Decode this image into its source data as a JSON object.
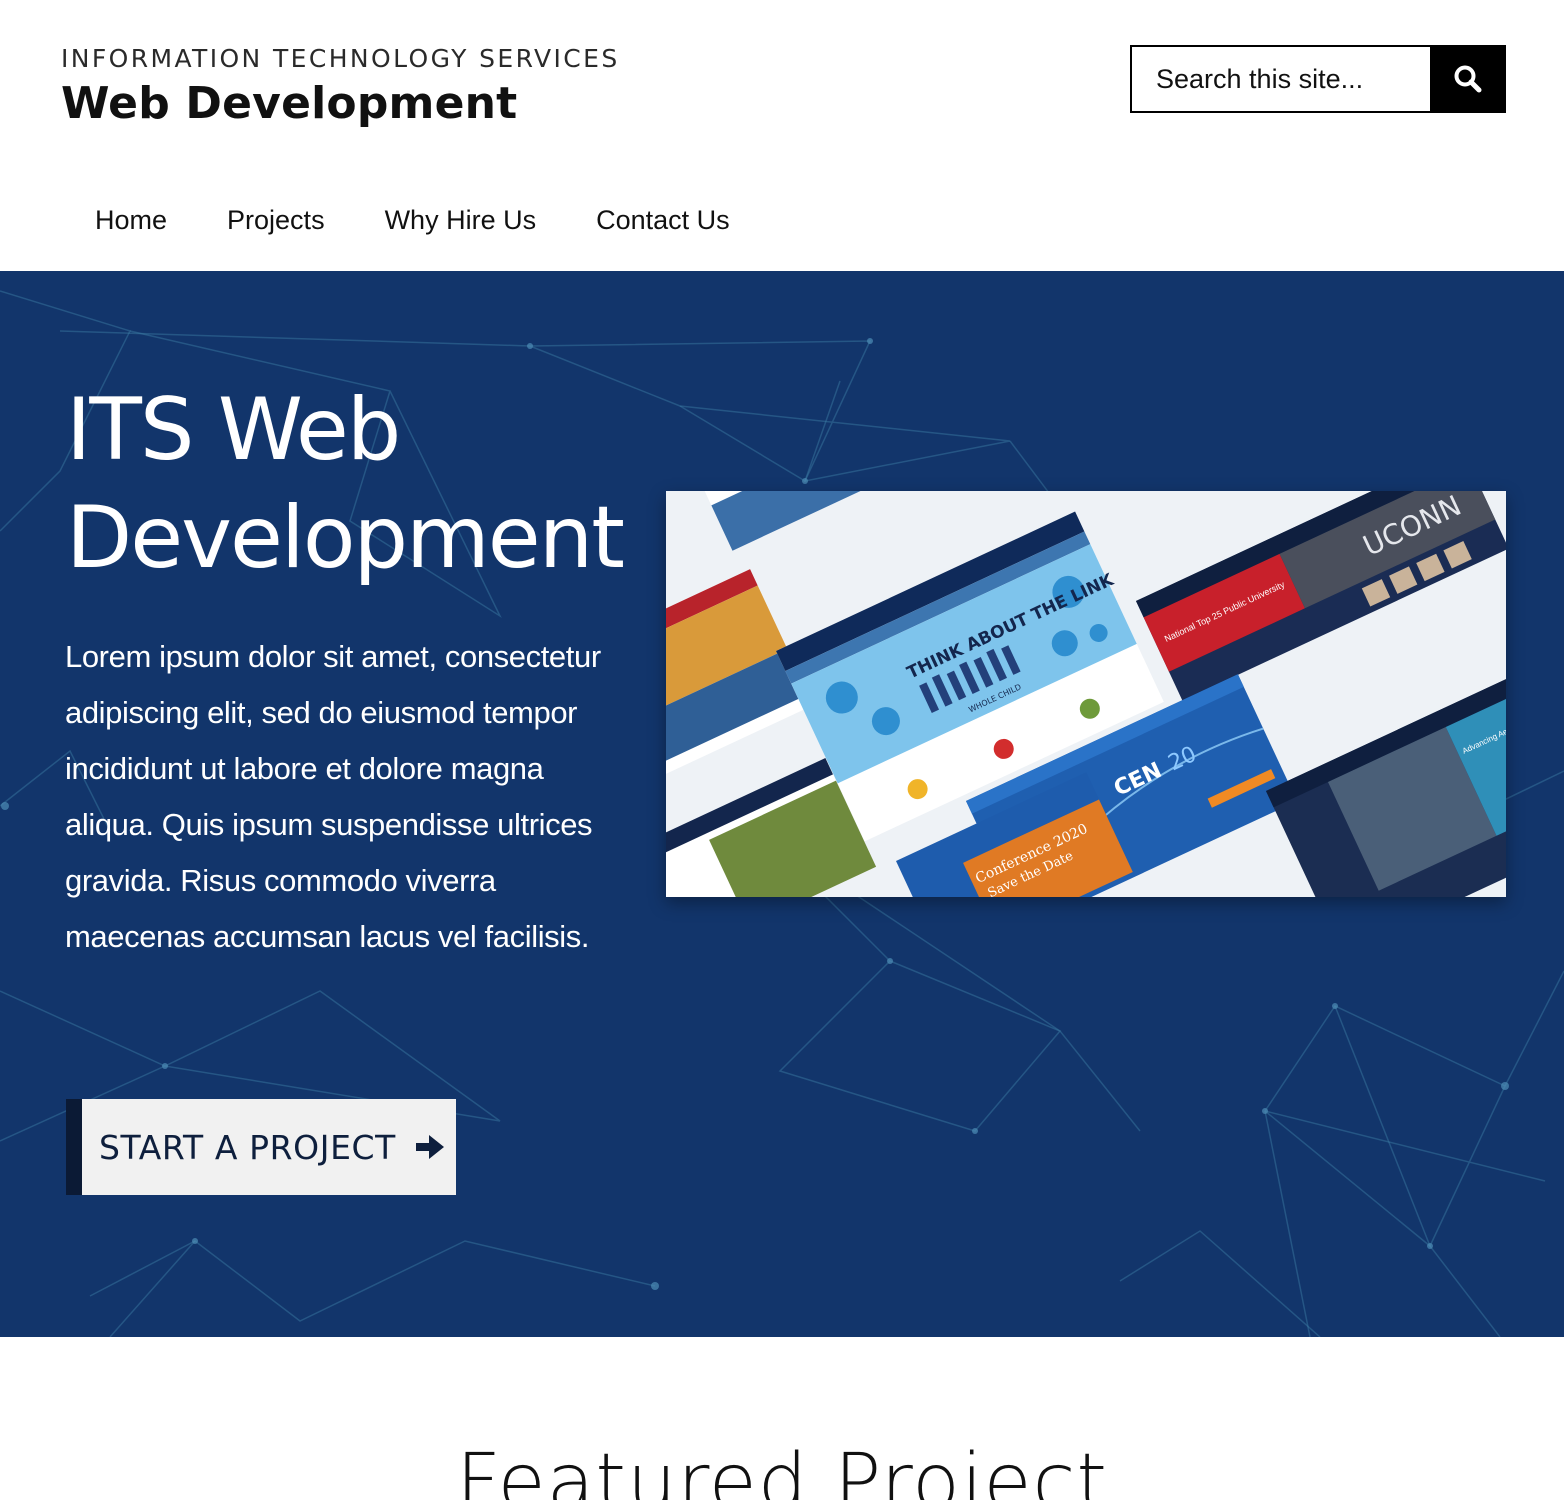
{
  "header": {
    "org_name": "INFORMATION TECHNOLOGY SERVICES",
    "site_title": "Web Development",
    "search": {
      "placeholder": "Search this site...",
      "button_icon": "search-icon"
    }
  },
  "nav": {
    "items": [
      {
        "label": "Home"
      },
      {
        "label": "Projects"
      },
      {
        "label": "Why Hire Us"
      },
      {
        "label": "Contact Us"
      }
    ]
  },
  "hero": {
    "title_line1": "ITS Web",
    "title_line2": "Development",
    "body": "Lorem ipsum dolor sit amet, consectetur adipiscing elit, sed do eiusmod tempor incididunt ut labore et dolore magna aliqua. Quis ipsum suspendisse ultrices gravida. Risus commodo viverra maecenas accumsan lacus vel facilisis.",
    "cta_label": "START A PROJECT",
    "cta_icon": "arrow-right-icon",
    "image_texts": {
      "card1_heading": "THINK ABOUT THE LINK",
      "card1_sub": "WHOLE CHILD",
      "card2_brand": "UCONN",
      "card2_tag": "National Top 25 Public University",
      "card3_brand": "CEN",
      "card3_year": "20",
      "card4_heading": "Conference 2020",
      "card4_sub": "Save the Date",
      "card5_heading": "Advancing Aerospace Manufacturing"
    }
  },
  "colors": {
    "hero_bg": "#12356b",
    "cta_bg": "#f1f1f1",
    "cta_accent": "#0b1a35",
    "search_button": "#000000"
  },
  "featured": {
    "title": "Featured Project"
  }
}
